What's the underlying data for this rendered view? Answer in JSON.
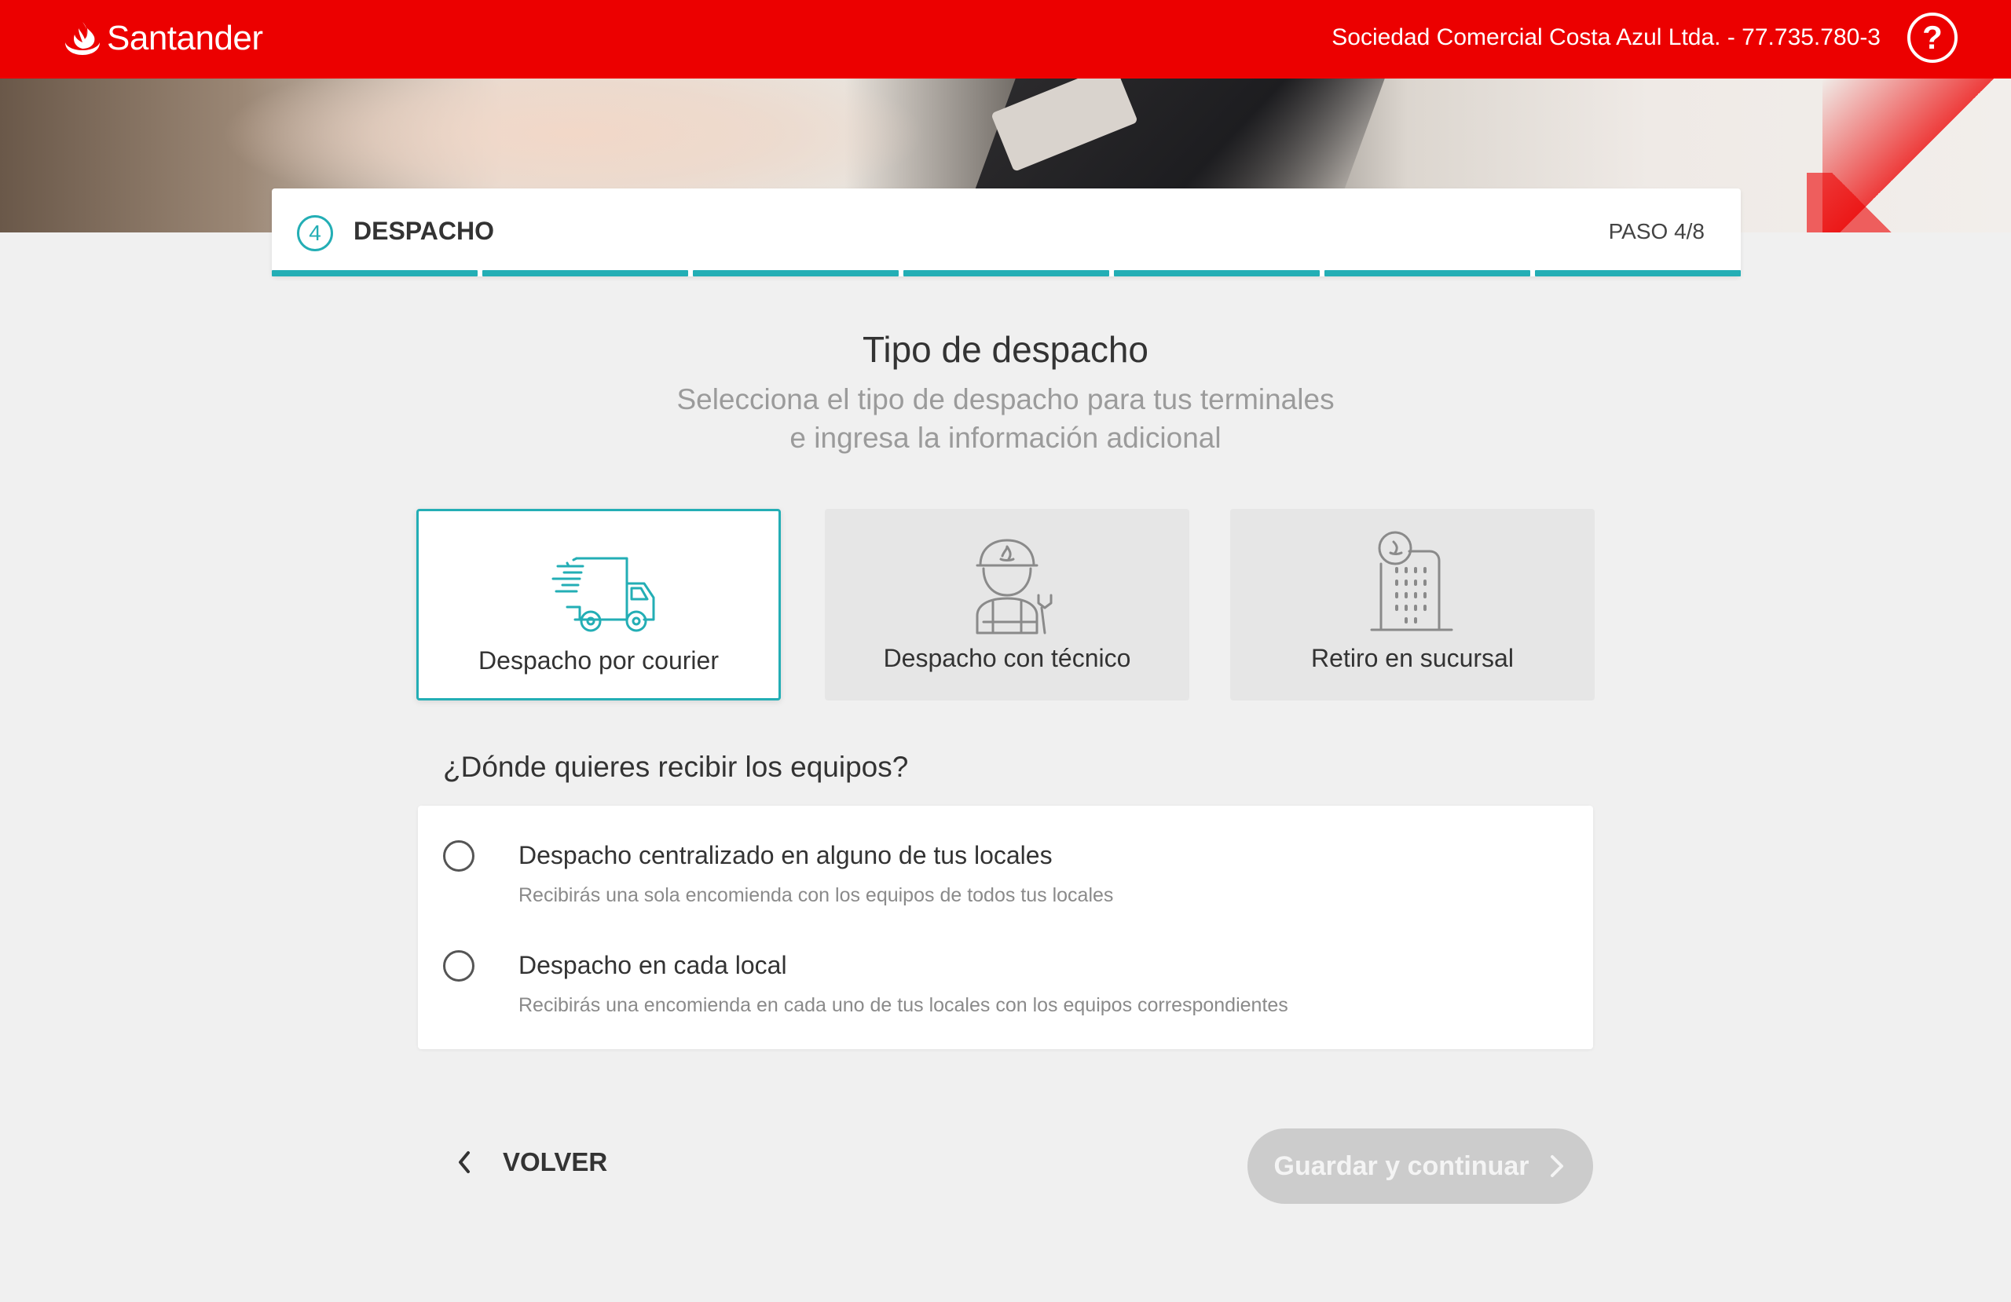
{
  "header": {
    "brand": "Santander",
    "company": "Sociedad Comercial Costa Azul Ltda. - 77.735.780-3",
    "help_label": "?",
    "brand_color": "#ec0000"
  },
  "step": {
    "number": "4",
    "title": "DESPACHO",
    "counter": "PASO 4/8",
    "accent_color": "#23aeb5"
  },
  "section": {
    "title": "Tipo de despacho",
    "subtitle_line1": "Selecciona el tipo de despacho para tus terminales",
    "subtitle_line2": "e ingresa la información adicional"
  },
  "options": [
    {
      "label": "Despacho por courier",
      "icon": "delivery-truck-icon",
      "selected": true
    },
    {
      "label": "Despacho con técnico",
      "icon": "technician-icon",
      "selected": false
    },
    {
      "label": "Retiro en sucursal",
      "icon": "bank-branch-icon",
      "selected": false
    }
  ],
  "delivery": {
    "question": "¿Dónde quieres recibir los equipos?",
    "choices": [
      {
        "label": "Despacho centralizado en alguno de tus locales",
        "description": "Recibirás una sola encomienda con los equipos de todos tus locales",
        "checked": false
      },
      {
        "label": "Despacho en cada local",
        "description": "Recibirás una encomienda en cada uno de tus locales con los equipos correspondientes",
        "checked": false
      }
    ]
  },
  "footer": {
    "back_label": "VOLVER",
    "continue_label": "Guardar y continuar",
    "continue_enabled": false
  }
}
